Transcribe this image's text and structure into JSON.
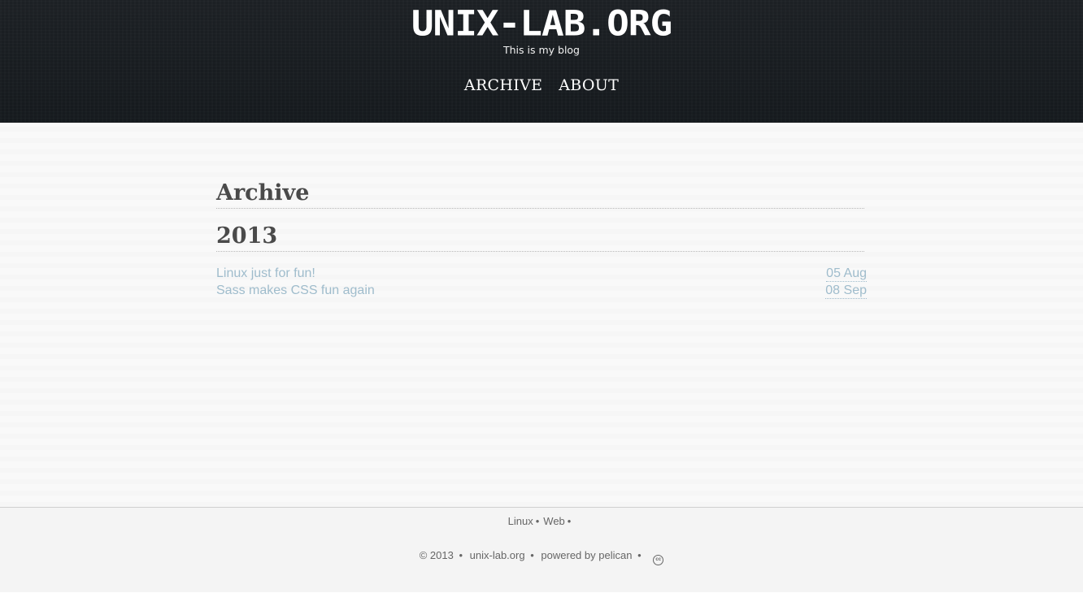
{
  "header": {
    "logo": "UNIX-LAB.ORG",
    "tagline": "This is my blog",
    "nav": [
      {
        "label": "ARCHIVE"
      },
      {
        "label": "ABOUT"
      }
    ]
  },
  "main": {
    "title": "Archive",
    "years": [
      {
        "year": "2013",
        "posts": [
          {
            "title": "Linux just for fun!",
            "date": "05 Aug"
          },
          {
            "title": "Sass makes CSS fun again",
            "date": "08 Sep"
          }
        ]
      }
    ]
  },
  "footer": {
    "categories": [
      {
        "label": "Linux"
      },
      {
        "label": "Web"
      }
    ],
    "bullet": "•",
    "copyright": "© 2013",
    "site": "unix-lab.org",
    "powered_by": "powered by",
    "engine": "pelican",
    "cc_icon": "creative-commons-icon",
    "cc_glyph": "cc"
  },
  "colors": {
    "header_bg": "#1a1e22",
    "link": "#9fbccc",
    "heading": "#4a4a4a",
    "footer_text": "#666666"
  }
}
